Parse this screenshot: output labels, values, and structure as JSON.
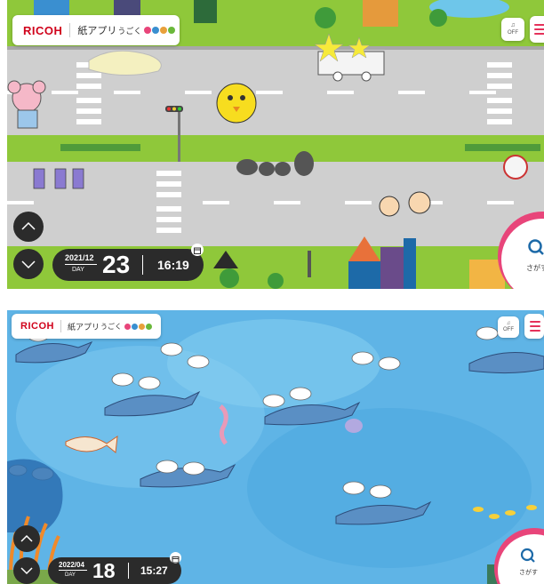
{
  "screens": [
    {
      "brand": "RICOH",
      "app_title": "紙アプリ",
      "app_subtitle": "うごく",
      "sound_label": "OFF",
      "date_year_month": "2021/12",
      "day_label": "DAY",
      "day_number": "23",
      "time": "16:19",
      "search_label": "さがす",
      "scene": "town"
    },
    {
      "brand": "RICOH",
      "app_title": "紙アプリ",
      "app_subtitle": "うごく",
      "sound_label": "OFF",
      "date_year_month": "2022/04",
      "day_label": "DAY",
      "day_number": "18",
      "time": "15:27",
      "search_label": "さがす",
      "scene": "ocean"
    }
  ],
  "colors": {
    "brand_red": "#d0021b",
    "accent_pink": "#e8457a",
    "control_dark": "#2b2b2b",
    "town_grass": "#8fc83a",
    "town_road": "#c9c9c9",
    "ocean_blue": "#5fb4e6"
  },
  "icons": {
    "up": "chevron-up-icon",
    "down": "chevron-down-icon",
    "calendar": "calendar-icon",
    "search": "search-icon",
    "menu": "menu-icon",
    "sound": "speaker-icon"
  }
}
